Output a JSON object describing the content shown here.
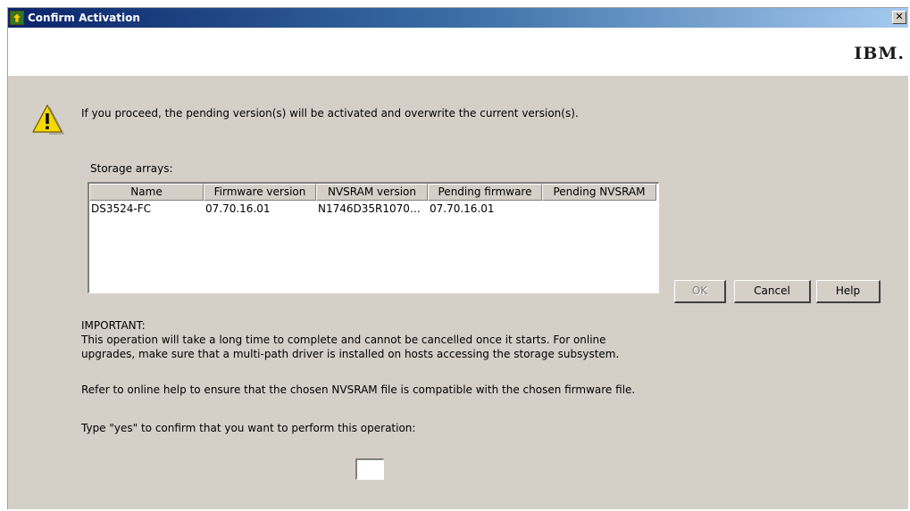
{
  "window": {
    "title": "Confirm Activation",
    "close_glyph": "✕",
    "logo_text": "IBM."
  },
  "message": {
    "icon": "warning-icon",
    "text": "If you proceed, the pending version(s) will be activated and overwrite the current version(s)."
  },
  "storage_arrays": {
    "label": "Storage arrays:",
    "columns": [
      "Name",
      "Firmware version",
      "NVSRAM version",
      "Pending firmware",
      "Pending NVSRAM"
    ],
    "rows": [
      [
        "DS3524-FC",
        "07.70.16.01",
        "N1746D35R1070…",
        "07.70.16.01",
        ""
      ]
    ]
  },
  "buttons": {
    "ok": "OK",
    "cancel": "Cancel",
    "help": "Help"
  },
  "important": {
    "heading": "IMPORTANT:",
    "line1": "This operation will take a long time to complete and cannot be cancelled once it starts. For online",
    "line2": "upgrades, make sure that a multi-path driver is installed on hosts accessing the storage subsystem.",
    "nvram_note": "Refer to online help to ensure that the chosen NVSRAM file is compatible with the chosen firmware file."
  },
  "confirm": {
    "prompt": "Type \"yes\" to confirm that you want to perform this operation:",
    "value": ""
  },
  "colors": {
    "titlebar_start": "#0a246a",
    "titlebar_end": "#a6caf0",
    "dialog_bg": "#d4d0c8",
    "warning_yellow": "#f5d800"
  }
}
